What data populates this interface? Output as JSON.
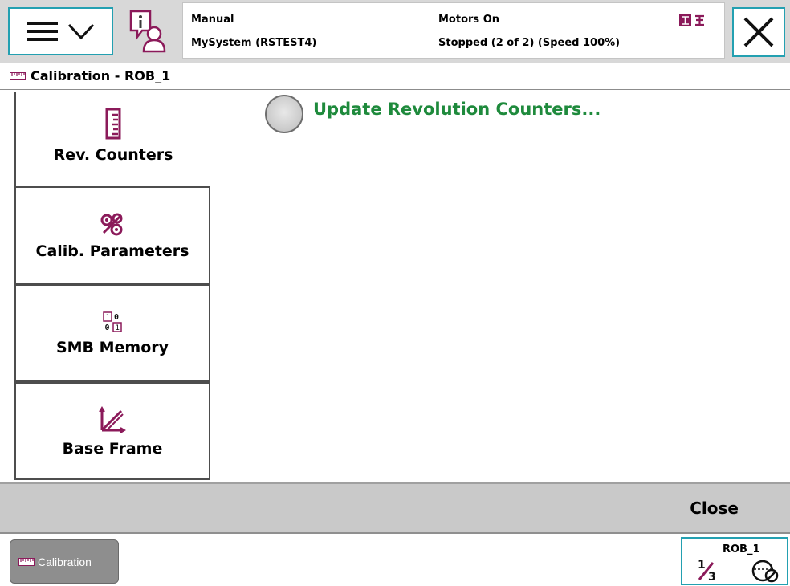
{
  "status": {
    "mode": "Manual",
    "system": "MySystem (RSTEST4)",
    "motors": "Motors On",
    "state": "Stopped (2 of 2) (Speed 100%)"
  },
  "window": {
    "title": "Calibration - ROB_1"
  },
  "sidebar": {
    "items": [
      {
        "label": "Rev. Counters",
        "icon": "ruler-icon"
      },
      {
        "label": "Calib. Parameters",
        "icon": "gears-icon"
      },
      {
        "label": "SMB Memory",
        "icon": "binary-memory-icon"
      },
      {
        "label": "Base Frame",
        "icon": "coordinate-frame-icon"
      }
    ]
  },
  "content": {
    "action": "Update Revolution Counters..."
  },
  "commands": {
    "close": "Close"
  },
  "taskbar": {
    "app": "Calibration"
  },
  "quickset": {
    "unit": "ROB_1"
  },
  "colors": {
    "accent": "#23a0b1",
    "icon": "#8b1a5a",
    "link_green": "#1e8a3c"
  }
}
